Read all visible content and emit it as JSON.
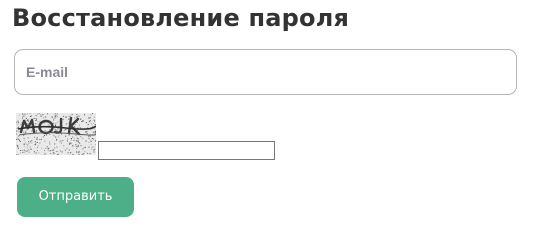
{
  "page": {
    "title": "Восстановление пароля"
  },
  "form": {
    "email_placeholder": "E-mail",
    "email_value": "",
    "captcha_text": "MOJK",
    "captcha_value": "",
    "submit_label": "Отправить"
  },
  "colors": {
    "title": "#333333",
    "button_bg": "#4caf87",
    "button_text": "#ffffff",
    "field_border": "#b5b5b5",
    "placeholder": "#8a8a94"
  }
}
